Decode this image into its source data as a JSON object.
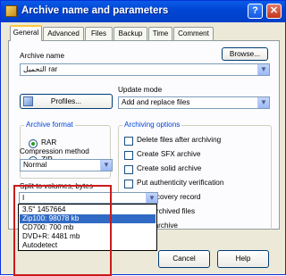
{
  "window": {
    "title": "Archive name and parameters",
    "help_glyph": "?",
    "close_glyph": "✕"
  },
  "tabs": [
    "General",
    "Advanced",
    "Files",
    "Backup",
    "Time",
    "Comment"
  ],
  "archive_name": {
    "label": "Archive name",
    "value": "التحميل rar",
    "browse_label": "Browse..."
  },
  "profiles_label": "Profiles...",
  "update_mode": {
    "label": "Update mode",
    "value": "Add and replace files"
  },
  "archive_format": {
    "label": "Archive format",
    "options": [
      "RAR",
      "ZIP"
    ],
    "selected": "RAR"
  },
  "archiving_options": {
    "label": "Archiving options",
    "items": [
      "Delete files after archiving",
      "Create SFX archive",
      "Create solid archive",
      "Put authenticity verification",
      "Put recovery record",
      "Test archived files",
      "Lock archive"
    ]
  },
  "compression": {
    "label": "Compression method",
    "value": "Normal"
  },
  "split": {
    "label": "Split to volumes, bytes",
    "value": "I",
    "options": [
      "3.5\"    1457664",
      "Zip100: 98078 kb",
      "CD700: 700 mb",
      "DVD+R: 4481 mb",
      "Autodetect"
    ],
    "highlighted": "Zip100: 98078 kb"
  },
  "footer": {
    "cancel_label": "Cancel",
    "help_label": "Help"
  },
  "colors": {
    "titlebar": "#0a5ce8",
    "highlight": "#316ac5",
    "annotation_box": "#cc1a1a",
    "group_title": "#0046d5"
  }
}
